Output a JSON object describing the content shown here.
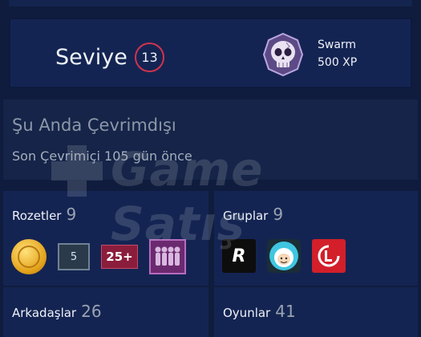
{
  "level": {
    "label": "Seviye",
    "number": "13"
  },
  "featured_badge": {
    "name": "Swarm",
    "xp": "500 XP",
    "icon": "skull-badge-icon"
  },
  "status": {
    "title": "Şu Anda Çevrimdışı",
    "last_online": "Son Çevrimiçi 105 gün önce"
  },
  "watermark": {
    "text": "Game Satış"
  },
  "badges": {
    "label": "Rozetler",
    "count": "9",
    "items": [
      {
        "icon": "gold-coin-badge-icon"
      },
      {
        "icon": "years-badge-icon",
        "text": "5"
      },
      {
        "icon": "games-owned-badge-icon",
        "text": "25+"
      },
      {
        "icon": "community-badge-icon"
      }
    ]
  },
  "groups": {
    "label": "Gruplar",
    "count": "9",
    "items": [
      {
        "icon": "group-r-logo-icon"
      },
      {
        "icon": "group-finn-avatar-icon"
      },
      {
        "icon": "group-red-logo-icon"
      }
    ]
  },
  "friends": {
    "label": "Arkadaşlar",
    "count": "26"
  },
  "games": {
    "label": "Oyunlar",
    "count": "41"
  },
  "colors": {
    "background": "#0f1c3d",
    "panel": "#142452",
    "level_ring": "#d0334e"
  }
}
